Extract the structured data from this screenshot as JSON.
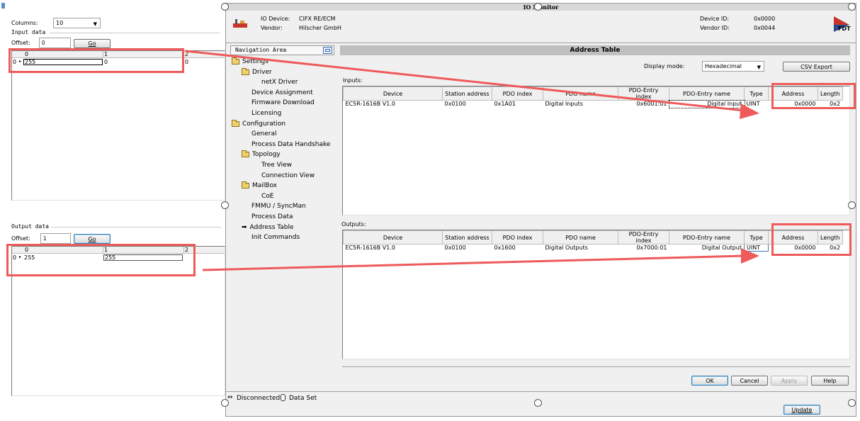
{
  "left_panel": {
    "columns_label": "Columns:",
    "columns_value": "10",
    "input_group_label": "Input data",
    "input_offset_label": "Offset:",
    "input_offset_value": "0",
    "go_label": "Go",
    "input_grid": {
      "col_headers": [
        "0",
        "1",
        "2"
      ],
      "row_header": "0",
      "cells": [
        "255",
        "0",
        "0"
      ]
    },
    "output_group_label": "Output data",
    "output_offset_label": "Offset:",
    "output_offset_value": "1",
    "output_grid": {
      "col_headers": [
        "0",
        "1",
        "2"
      ],
      "row_header": "0",
      "cells": [
        "255",
        "255"
      ]
    }
  },
  "window": {
    "title": "IO Monitor",
    "io_device_label": "IO Device:",
    "io_device_value": "CIFX RE/ECM",
    "vendor_label": "Vendor:",
    "vendor_value": "Hilscher GmbH",
    "device_id_label": "Device ID:",
    "device_id_value": "0x0000",
    "vendor_id_label": "Vendor ID:",
    "vendor_id_value": "0x0044",
    "fdt_logo": "FDT"
  },
  "nav": {
    "title": "Navigation Area",
    "items": [
      {
        "label": "Settings",
        "type": "folder",
        "level": 0
      },
      {
        "label": "Driver",
        "type": "folder",
        "level": 1
      },
      {
        "label": "netX Driver",
        "type": "leaf",
        "level": 2
      },
      {
        "label": "Device Assignment",
        "type": "leaf",
        "level": 1
      },
      {
        "label": "Firmware Download",
        "type": "leaf",
        "level": 1
      },
      {
        "label": "Licensing",
        "type": "leaf",
        "level": 1
      },
      {
        "label": "Configuration",
        "type": "folder",
        "level": 0
      },
      {
        "label": "General",
        "type": "leaf",
        "level": 1
      },
      {
        "label": "Process Data Handshake",
        "type": "leaf",
        "level": 1
      },
      {
        "label": "Topology",
        "type": "folder",
        "level": 1
      },
      {
        "label": "Tree View",
        "type": "leaf",
        "level": 2
      },
      {
        "label": "Connection View",
        "type": "leaf",
        "level": 2
      },
      {
        "label": "MailBox",
        "type": "folder",
        "level": 1
      },
      {
        "label": "CoE",
        "type": "leaf",
        "level": 2
      },
      {
        "label": "FMMU / SyncMan",
        "type": "leaf",
        "level": 1
      },
      {
        "label": "Process Data",
        "type": "leaf",
        "level": 1
      },
      {
        "label": "Address Table",
        "type": "selected",
        "level": 1
      },
      {
        "label": "Init Commands",
        "type": "leaf",
        "level": 1
      }
    ]
  },
  "address_table": {
    "title": "Address Table",
    "display_mode_label": "Display mode:",
    "display_mode_value": "Hexadecimal",
    "csv_export_label": "CSV Export",
    "columns": [
      "Device",
      "Station address",
      "PDO index",
      "PDO name",
      "PDO-Entry index",
      "PDO-Entry name",
      "Type",
      "Address",
      "Length"
    ],
    "inputs_label": "Inputs:",
    "inputs_rows": [
      [
        "EC5R-1616B V1.0",
        "0x0100",
        "0x1A01",
        "Digital Inputs",
        "0x6001:01",
        "Digital Input",
        "UINT",
        "0x0000",
        "0x2"
      ]
    ],
    "outputs_label": "Outputs:",
    "outputs_rows": [
      [
        "EC5R-1616B V1.0",
        "0x0100",
        "0x1600",
        "Digital Outputs",
        "0x7000:01",
        "Digital Output",
        "UINT",
        "0x0000",
        "0x2"
      ]
    ]
  },
  "buttons": {
    "ok": "OK",
    "cancel": "Cancel",
    "apply": "Apply",
    "help": "Help",
    "update": "Update"
  },
  "status_bar": {
    "connection": "Disconnected",
    "dataset": "Data Set"
  },
  "colors": {
    "annotation_red": "#ef5a5a",
    "title_bar": "#d8d8d8",
    "header_bar": "#bfbfbf"
  }
}
